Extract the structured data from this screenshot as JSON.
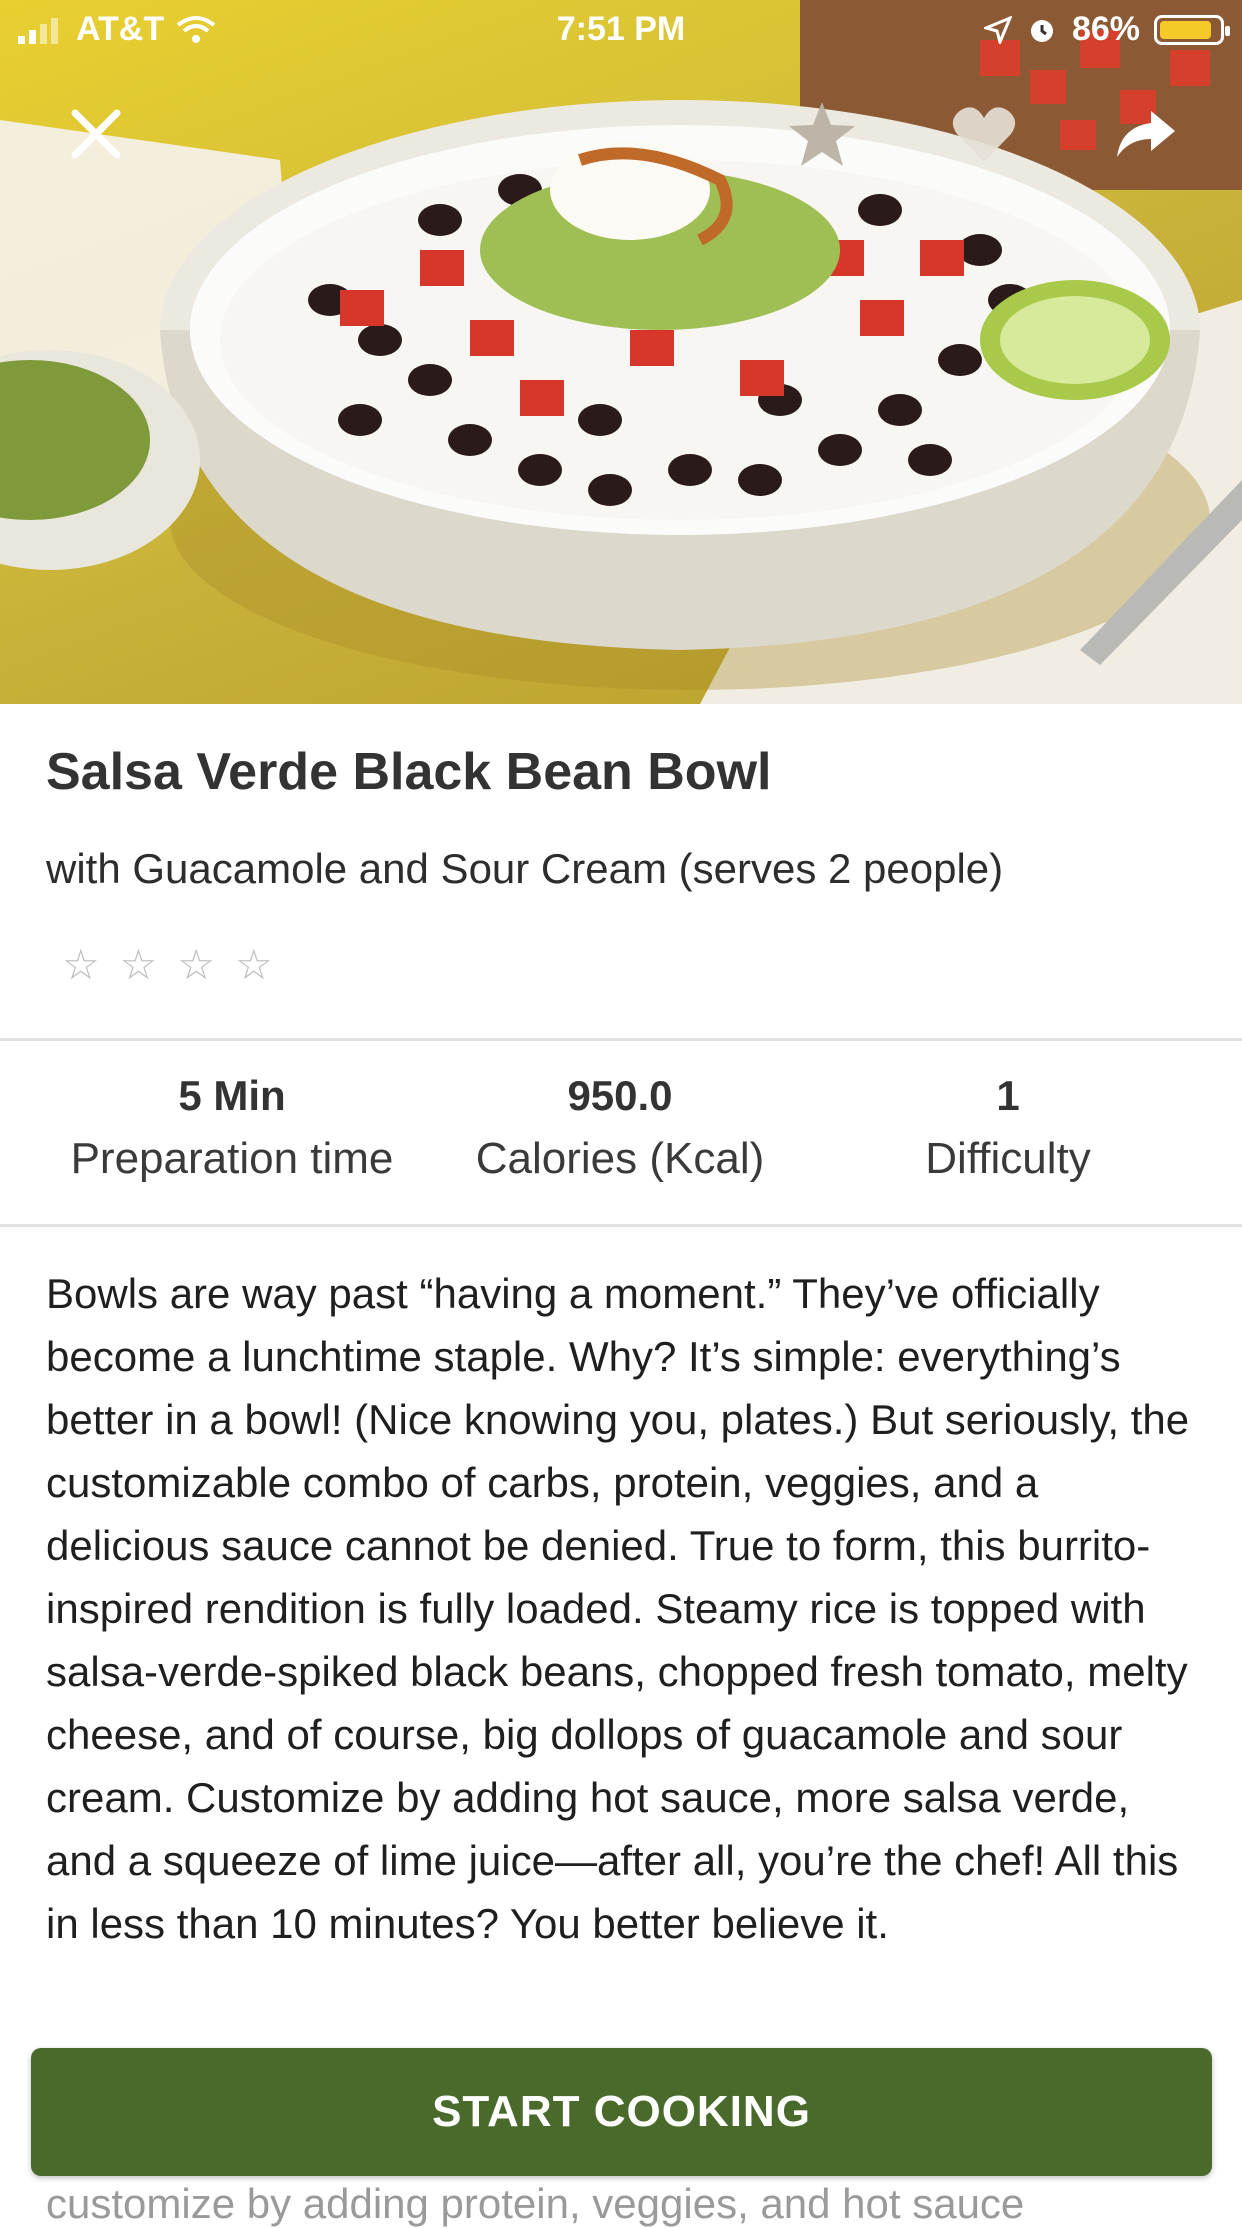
{
  "status_bar": {
    "carrier": "AT&T",
    "time": "7:51 PM",
    "battery": "86%",
    "battery_level": 0.86
  },
  "hero": {
    "icons": [
      "close-icon",
      "star-icon",
      "heart-icon",
      "share-icon"
    ]
  },
  "recipe": {
    "title": "Salsa Verde Black Bean Bowl",
    "subtitle": "with Guacamole and Sour Cream (serves 2 people)",
    "rating": 0,
    "rating_max": 4
  },
  "stats": [
    {
      "value": "5 Min",
      "label": "Preparation time"
    },
    {
      "value": "950.0",
      "label": "Calories (Kcal)"
    },
    {
      "value": "1",
      "label": "Difficulty"
    }
  ],
  "description": "Bowls are way past “having a moment.” They’ve officially become a lunchtime staple. Why? It’s simple: everything’s better in a bowl! (Nice knowing you, plates.) But seriously, the customizable combo of carbs, protein, veggies, and a delicious sauce cannot be denied. True to form, this burrito-inspired rendition is fully loaded. Steamy rice is topped with salsa-verde-spiked black beans, chopped fresh tomato, melty cheese, and of course, big dollops of guacamole and sour cream. Customize by adding hot sauce, more salsa verde, and a squeeze of lime juice—after all, you’re the chef! All this in less than 10 minutes? You better believe it.",
  "start_button": "START COOKING",
  "peek_text": "customize by adding protein, veggies, and hot sauce",
  "colors": {
    "accent": "#4a6a2c",
    "battery": "#f5c928"
  }
}
